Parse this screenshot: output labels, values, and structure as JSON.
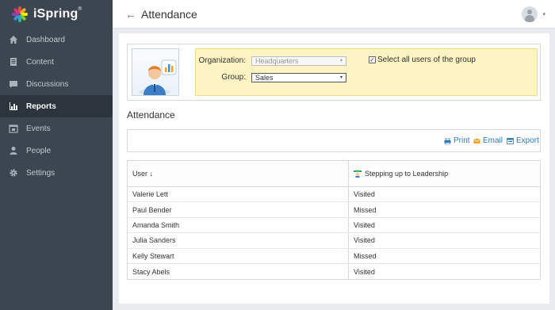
{
  "app": {
    "name": "iSpring",
    "trademark": "®"
  },
  "sidebar": {
    "items": [
      {
        "label": "Dashboard",
        "icon": "home-icon"
      },
      {
        "label": "Content",
        "icon": "document-icon"
      },
      {
        "label": "Discussions",
        "icon": "chat-icon"
      },
      {
        "label": "Reports",
        "icon": "bar-chart-icon",
        "active": true
      },
      {
        "label": "Events",
        "icon": "calendar-icon"
      },
      {
        "label": "People",
        "icon": "person-icon"
      },
      {
        "label": "Settings",
        "icon": "gear-icon"
      }
    ]
  },
  "header": {
    "title": "Attendance",
    "back_icon": "←",
    "avatar_caret": "▾"
  },
  "filters": {
    "organization_label": "Organization:",
    "organization_value": "Headquarters",
    "group_label": "Group:",
    "group_value": "Sales",
    "select_all_label": "Select all users of the group",
    "select_all_checked": "✓",
    "caret": "▾"
  },
  "section": {
    "title": "Attendance"
  },
  "toolbar": {
    "print": "Print",
    "email": "Email",
    "export": "Export"
  },
  "table": {
    "headers": {
      "user": "User ↓",
      "course": "Stepping up to Leadership"
    },
    "rows": [
      {
        "user": "Valerie Lett",
        "status": "Visited"
      },
      {
        "user": "Paul Bender",
        "status": "Missed"
      },
      {
        "user": "Amanda Smith",
        "status": "Visited"
      },
      {
        "user": "Julia Sanders",
        "status": "Visited"
      },
      {
        "user": "Kelly Stewart",
        "status": "Missed"
      },
      {
        "user": "Stacy Abels",
        "status": "Visited"
      }
    ]
  },
  "colors": {
    "sidebar": "#3b4650",
    "sidebar_active": "#2c353d",
    "link": "#2b7ac0",
    "filter_panel": "#fdf3c3"
  }
}
